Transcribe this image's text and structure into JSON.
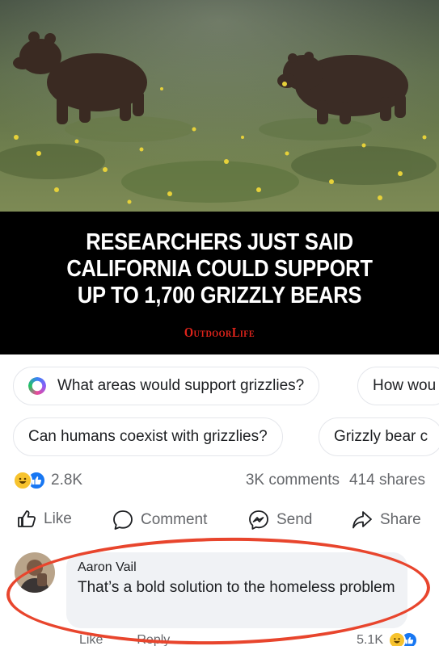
{
  "post": {
    "image_alt": "Two grizzly bears walking through a meadow with yellow wildflowers",
    "headline_lines": [
      "RESEARCHERS JUST SAID",
      "CALIFORNIA COULD SUPPORT",
      "UP TO 1,700 GRIZZLY BEARS"
    ],
    "brand": "OutdoorLife"
  },
  "suggestions": {
    "row1": [
      "What areas would support grizzlies?",
      "How wou"
    ],
    "row2": [
      "Can humans coexist with grizzlies?",
      "Grizzly bear c"
    ]
  },
  "stats": {
    "reactions_count": "2.8K",
    "comments": "3K comments",
    "shares": "414 shares"
  },
  "actions": {
    "like": "Like",
    "comment": "Comment",
    "send": "Send",
    "share": "Share"
  },
  "comment": {
    "author": "Aaron Vail",
    "text": "That’s a bold solution to the homeless problem",
    "like_label": "Like",
    "reply_label": "Reply",
    "reactions_count": "5.1K"
  },
  "colors": {
    "accent": "#1877f2",
    "haha": "#f7c32e",
    "annotation": "#e8452d",
    "brand": "#e0241b"
  }
}
